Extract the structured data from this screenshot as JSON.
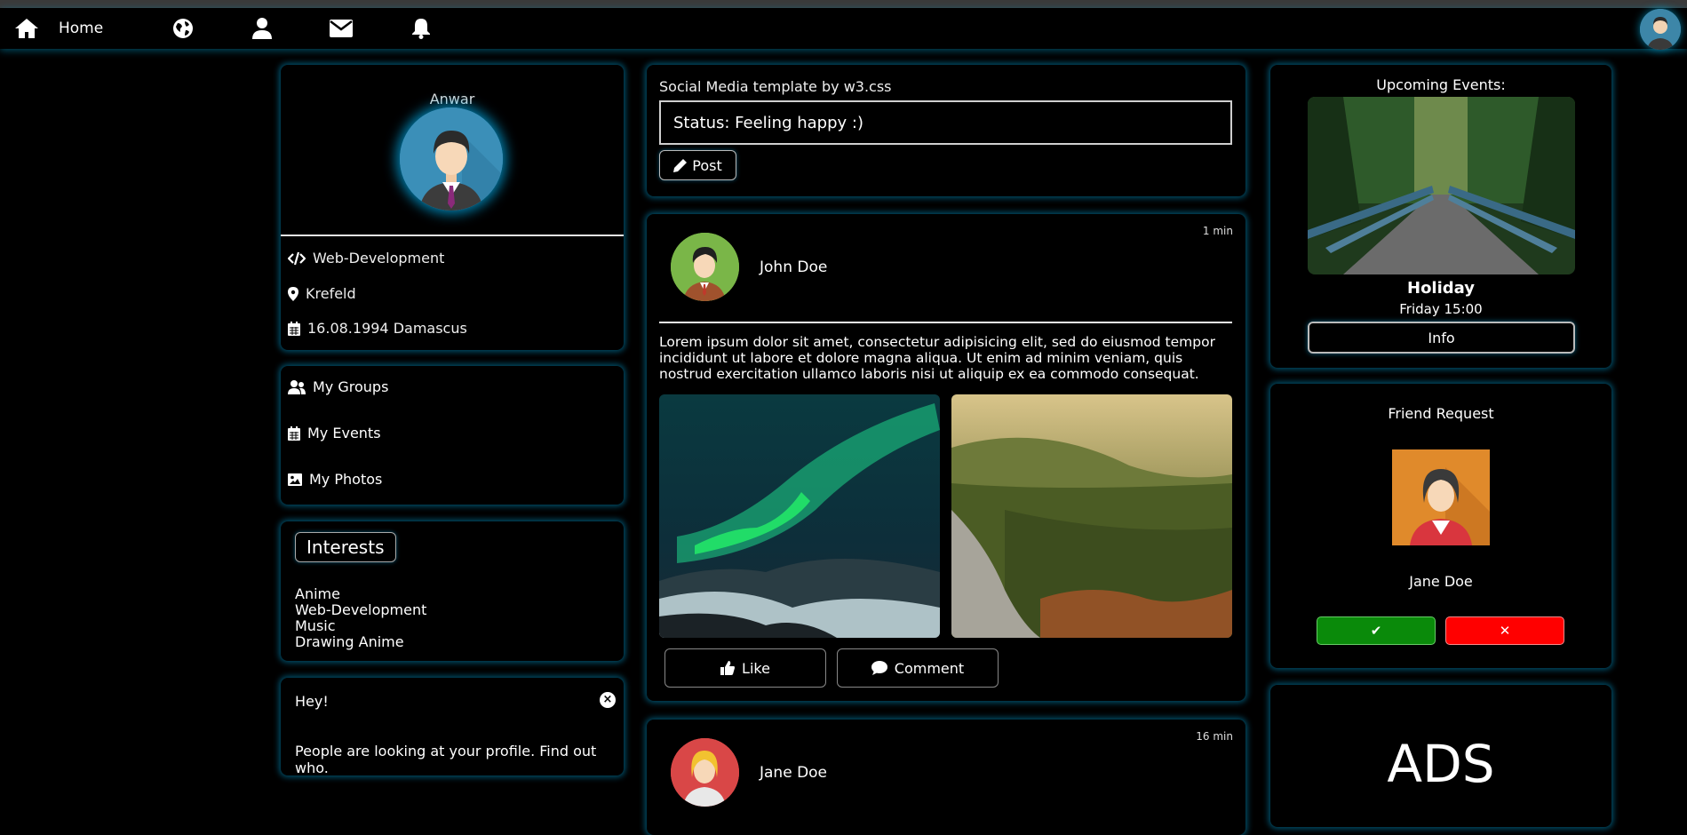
{
  "nav": {
    "home_label": "Home",
    "icons": [
      "home-icon",
      "globe-icon",
      "user-icon",
      "envelope-icon",
      "bell-icon"
    ]
  },
  "profile": {
    "name": "Anwar",
    "job": "Web-Development",
    "location": "Krefeld",
    "birth": "16.08.1994 Damascus"
  },
  "links": {
    "groups": "My Groups",
    "events": "My Events",
    "photos": "My Photos"
  },
  "interests": {
    "title": "Interests",
    "items": [
      "Anime",
      "Web-Development",
      "Music",
      "Drawing Anime"
    ]
  },
  "alert": {
    "title": "Hey!",
    "close": "×",
    "message": "People are looking at your profile. Find out who."
  },
  "status": {
    "heading": "Social Media template by w3.css",
    "value": "Status: Feeling happy :)",
    "post_label": "Post"
  },
  "post1": {
    "time": "1 min",
    "author": "John Doe",
    "text": "Lorem ipsum dolor sit amet, consectetur adipisicing elit, sed do eiusmod tempor incididunt ut labore et dolore magna aliqua. Ut enim ad minim veniam, quis nostrud exercitation ullamco laboris nisi ut aliquip ex ea commodo consequat.",
    "like_label": "Like",
    "comment_label": "Comment"
  },
  "post2": {
    "time": "16 min",
    "author": "Jane Doe"
  },
  "events": {
    "heading": "Upcoming Events:",
    "title": "Holiday",
    "date": "Friday 15:00",
    "info_label": "Info"
  },
  "friend": {
    "heading": "Friend Request",
    "name": "Jane Doe",
    "accept": "✔",
    "decline": "✕"
  },
  "ads": {
    "text": "ADS"
  },
  "colors": {
    "background": "#000000",
    "glow": "#0096c8",
    "accept": "#0a8a0a",
    "decline": "#ff0000"
  }
}
